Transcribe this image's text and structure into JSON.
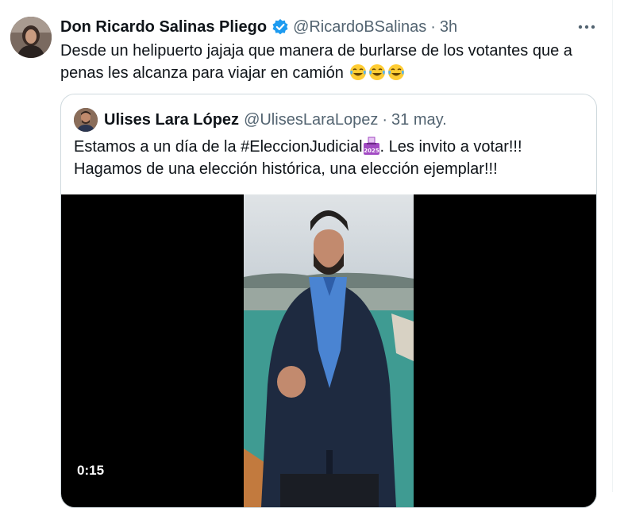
{
  "tweet": {
    "author_name": "Don Ricardo Salinas Pliego",
    "handle": "@RicardoBSalinas",
    "separator": "·",
    "time": "3h",
    "text": "Desde un helipuerto jajaja que manera de burlarse de los votantes que a penas les alcanza para viajar en camión",
    "emojis": [
      "face-with-tears-of-joy-icon",
      "face-with-tears-of-joy-icon",
      "face-with-tears-of-joy-icon"
    ],
    "verified_color": "#1d9bf0"
  },
  "quote": {
    "author_name": "Ulises Lara López",
    "handle": "@UlisesLaraLopez",
    "separator": "·",
    "date": "31 may.",
    "text_line1_before": "Estamos a un día de la #EleccionJudicial",
    "text_line1_after": ". Les invito a votar!!!",
    "text_line2": "Hagamos de una elección histórica, una elección ejemplar!!!",
    "ballot_badge": "2025",
    "video_duration": "0:15"
  },
  "colors": {
    "text": "#0f1419",
    "secondary": "#536471",
    "border": "#cfd9de",
    "accent": "#1d9bf0",
    "ballot": "#a24ac3"
  }
}
